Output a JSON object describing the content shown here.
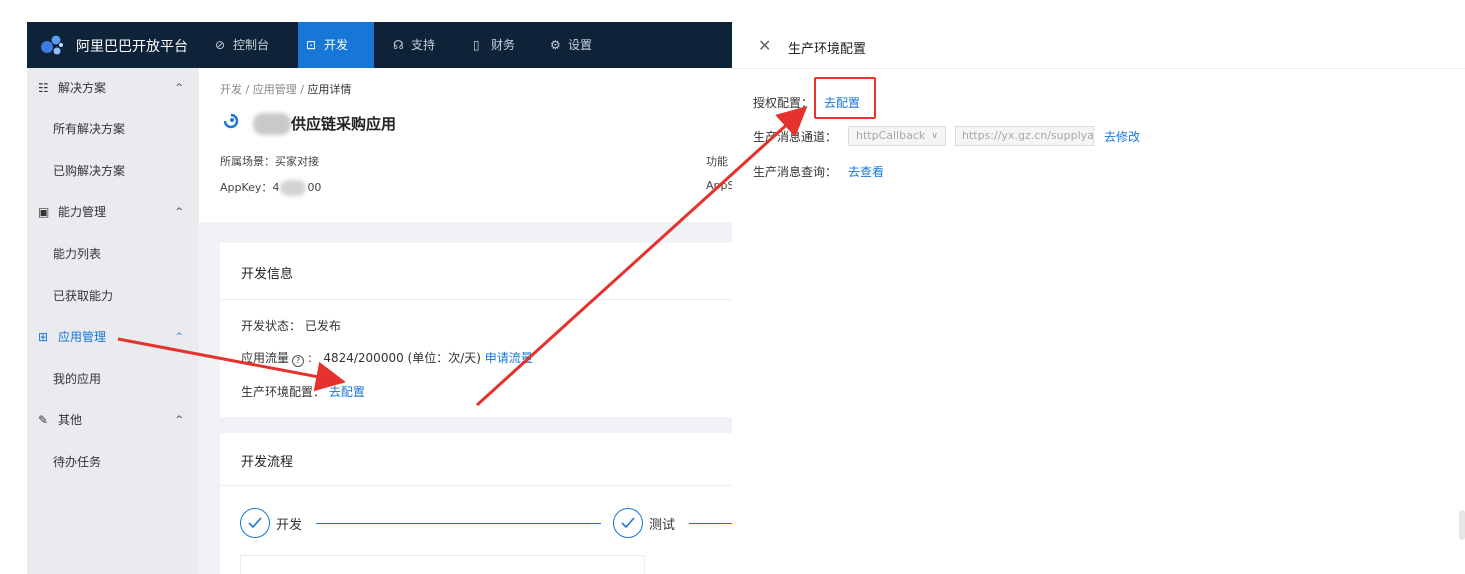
{
  "topnav": {
    "brand": "阿里巴巴开放平台",
    "items": [
      {
        "icon": "dashboard-icon",
        "glyph": "⊘",
        "label": "控制台",
        "active": false
      },
      {
        "icon": "terminal-icon",
        "glyph": "⊡",
        "label": "开发",
        "active": true
      },
      {
        "icon": "headset-icon",
        "glyph": "☊",
        "label": "支持",
        "active": false
      },
      {
        "icon": "bookmark-icon",
        "glyph": "▯",
        "label": "财务",
        "active": false
      },
      {
        "icon": "gear-icon",
        "glyph": "⚙",
        "label": "设置",
        "active": false
      }
    ]
  },
  "sidebar": {
    "groups": [
      {
        "icon": "solution-icon",
        "glyph": "☷",
        "label": "解决方案",
        "chev": "^",
        "items": [
          "所有解决方案",
          "已购解决方案"
        ]
      },
      {
        "icon": "capability-icon",
        "glyph": "▣",
        "label": "能力管理",
        "chev": "^",
        "items": [
          "能力列表",
          "已获取能力"
        ]
      },
      {
        "icon": "apps-icon",
        "glyph": "⊞",
        "label": "应用管理",
        "chev": "^",
        "items": [
          "我的应用"
        ]
      },
      {
        "icon": "edit-icon",
        "glyph": "✎",
        "label": "其他",
        "chev": "^",
        "items": [
          "待办任务"
        ]
      }
    ]
  },
  "breadcrumb": {
    "part1": "开发",
    "sep": "/",
    "part2": "应用管理",
    "part3": "应用详情"
  },
  "app": {
    "title": "供应链采购应用",
    "scene_label": "所属场景：",
    "scene_value": "买家对接",
    "appkey_label": "AppKey：",
    "appkey_prefix": "4",
    "appkey_suffix": "00",
    "right_meta1": "功能",
    "right_meta2": "AppS"
  },
  "dev_info": {
    "title": "开发信息",
    "status_label": "开发状态：",
    "status_value": "已发布",
    "traffic_label": "应用流量",
    "traffic_q": "?",
    "traffic_value": "4824/200000 (单位：次/天)",
    "traffic_link": "申请流量",
    "env_label": "生产环境配置：",
    "env_link": "去配置"
  },
  "dev_flow": {
    "title": "开发流程",
    "steps": [
      "开发",
      "测试"
    ]
  },
  "drawer": {
    "close": "✕",
    "title": "生产环境配置",
    "auth_label": "授权配置：",
    "auth_link": "去配置",
    "channel_label": "生产消息通道：",
    "channel_select": "httpCallback",
    "channel_arrow": "∨",
    "channel_url": "https://yx.gz.cn/supplya",
    "channel_link": "去修改",
    "query_label": "生产消息查询：",
    "query_link": "去查看"
  },
  "colors": {
    "accent": "#1677d8",
    "nav_bg": "#0e2238",
    "annotation_red": "#e5322d"
  }
}
